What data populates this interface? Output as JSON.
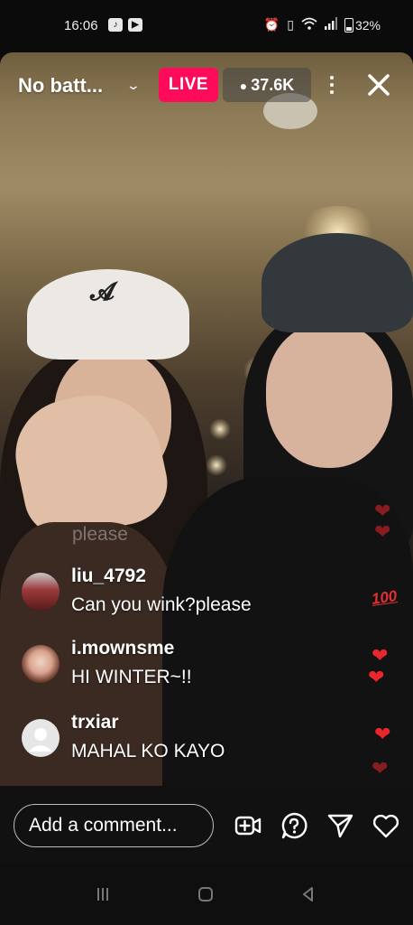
{
  "status_bar": {
    "time": "16:06",
    "battery": "32%",
    "icons": [
      "tiktok-icon",
      "youtube-icon",
      "alarm-icon",
      "vibrate-icon",
      "wifi-icon",
      "signal-icon",
      "battery-icon"
    ]
  },
  "live": {
    "title": "No batt...",
    "badge": "LIVE",
    "viewer_count": "37.6K",
    "accent_color": "#ff0b5c"
  },
  "comments": {
    "ghost_text": "please",
    "items": [
      {
        "username": "liu_4792",
        "text": "Can you wink?please"
      },
      {
        "username": "i.mownsme",
        "text": "HI WINTER~!!"
      },
      {
        "username": "trxiar",
        "text": "MAHAL KO KAYO"
      }
    ]
  },
  "reactions": {
    "heart": "❤",
    "hundred": "100"
  },
  "composer": {
    "placeholder": "Add a comment..."
  }
}
